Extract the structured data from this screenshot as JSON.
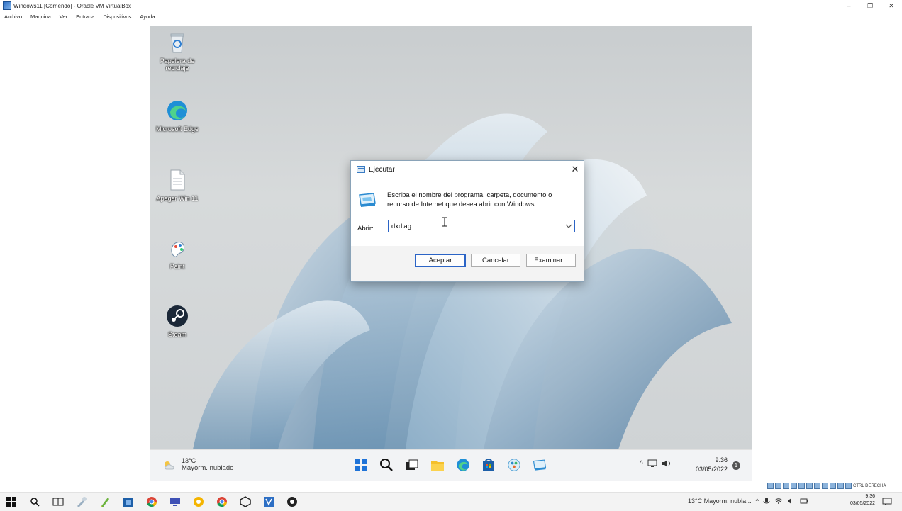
{
  "host_window": {
    "title": "Windows11 [Corriendo] - Oracle VM VirtualBox",
    "controls": [
      "–",
      "❐",
      "✕"
    ],
    "menu": [
      "Archivo",
      "Maquina",
      "Ver",
      "Entrada",
      "Dispositivos",
      "Ayuda"
    ]
  },
  "desktop": {
    "icons": [
      {
        "label": "Papelera de reciclaje",
        "icon": "recycle-bin-icon"
      },
      {
        "label": "Microsoft Edge",
        "icon": "edge-icon"
      },
      {
        "label": "Apagar Win 11",
        "icon": "document-icon"
      },
      {
        "label": "Paint",
        "icon": "paint-icon"
      },
      {
        "label": "Steam",
        "icon": "steam-icon"
      }
    ]
  },
  "run_dialog": {
    "title": "Ejecutar",
    "description": "Escriba el nombre del programa, carpeta, documento o recurso de Internet que desea abrir con Windows.",
    "open_label": "Abrir:",
    "input_value": "dxdiag",
    "ok_label": "Aceptar",
    "cancel_label": "Cancelar",
    "browse_label": "Examinar...",
    "close": "✕"
  },
  "guest_taskbar": {
    "weather_temp": "13°C",
    "weather_desc": "Mayorm. nublado",
    "pinned": [
      "start-icon",
      "search-icon",
      "task-view-icon",
      "file-explorer-icon",
      "edge-icon",
      "store-icon",
      "paint-icon",
      "run-icon"
    ],
    "time": "9:36",
    "date": "03/05/2022",
    "notifications": "1",
    "tray_chevron": "^"
  },
  "vbox_status": {
    "host_key": "CTRL DERECHA"
  },
  "host_taskbar": {
    "weather": "13°C  Mayorm. nubla...",
    "time": "9:36",
    "date": "03/05/2022",
    "tray_chevron": "^"
  },
  "colors": {
    "accent": "#2b64c6",
    "dialog_bg": "#f3f3f3",
    "taskbar_bg": "#f2f3f5"
  }
}
